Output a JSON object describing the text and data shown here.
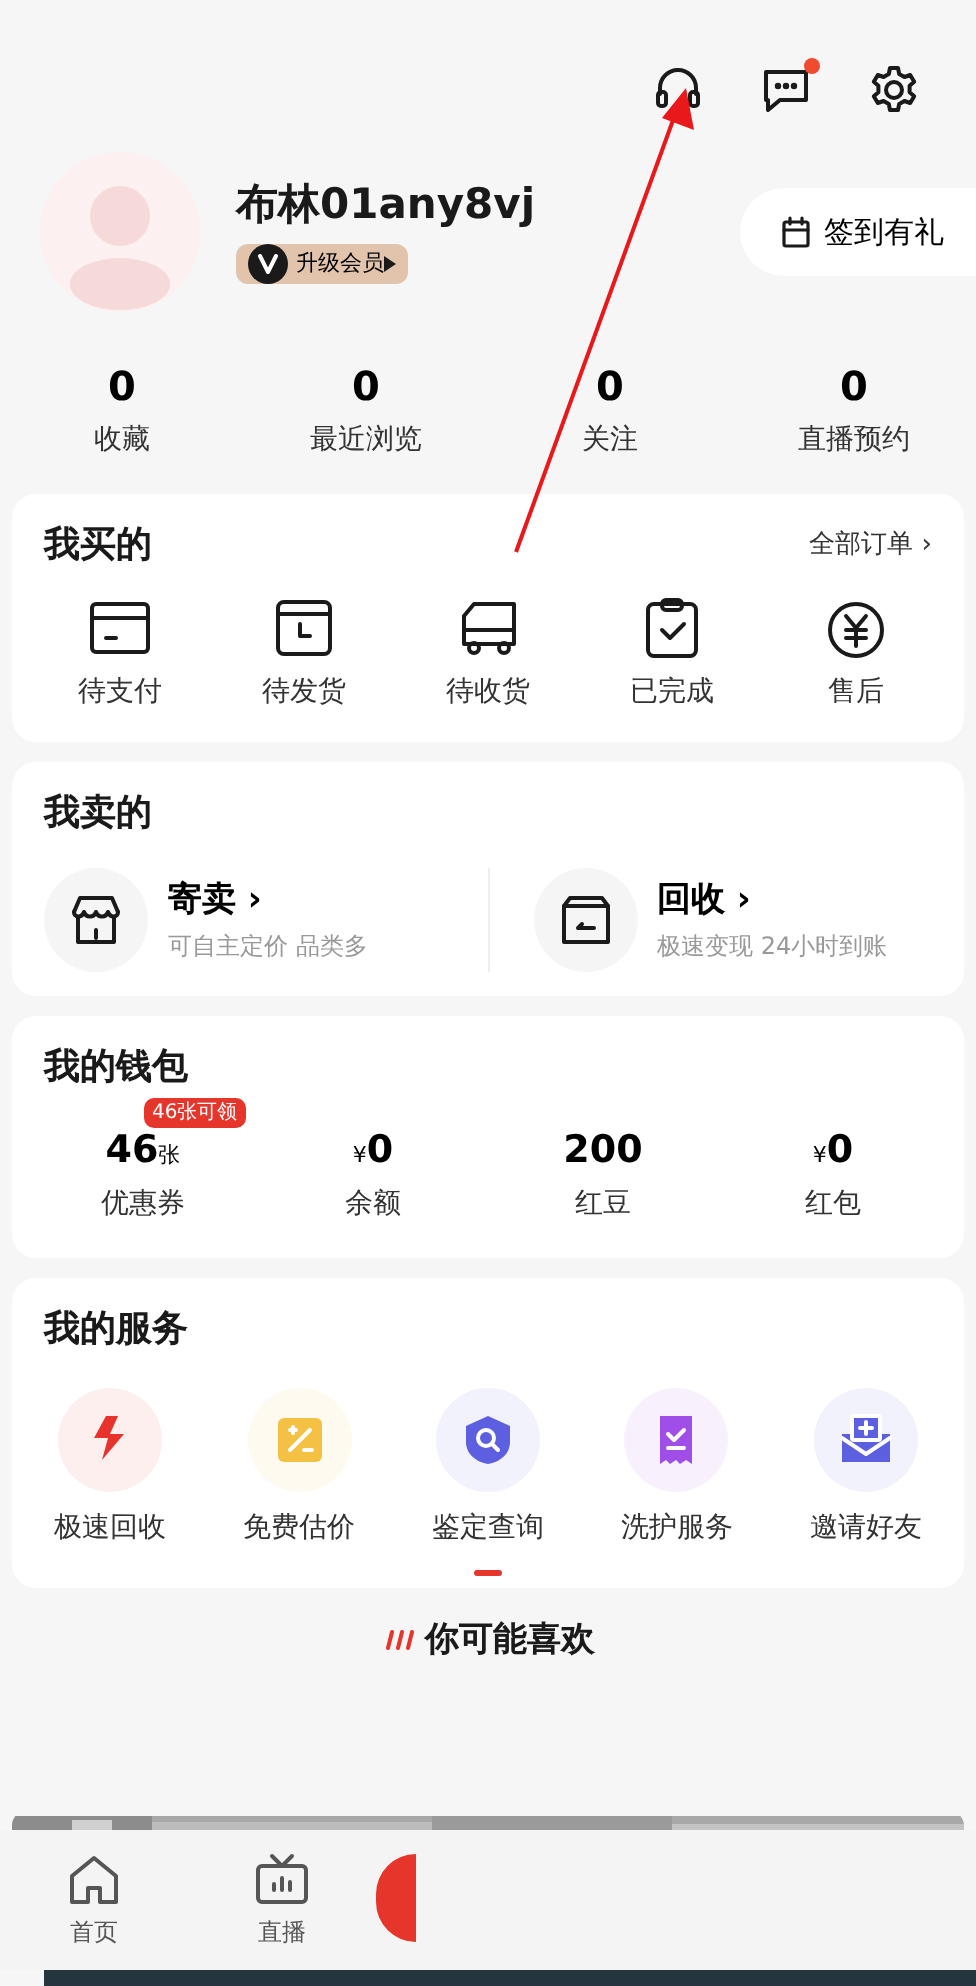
{
  "header": {
    "messages_unread": true
  },
  "profile": {
    "username": "布林01any8vj",
    "member_badge": "升级会员",
    "checkin_button": "签到有礼"
  },
  "stats": [
    {
      "value": "0",
      "label": "收藏"
    },
    {
      "value": "0",
      "label": "最近浏览"
    },
    {
      "value": "0",
      "label": "关注"
    },
    {
      "value": "0",
      "label": "直播预约"
    }
  ],
  "purchases": {
    "title": "我买的",
    "all_orders": "全部订单 ›",
    "items": [
      {
        "label": "待支付"
      },
      {
        "label": "待发货"
      },
      {
        "label": "待收货"
      },
      {
        "label": "已完成"
      },
      {
        "label": "售后"
      }
    ]
  },
  "selling": {
    "title": "我卖的",
    "items": [
      {
        "title": "寄卖 ›",
        "subtitle": "可自主定价 品类多"
      },
      {
        "title": "回收 ›",
        "subtitle": "极速变现 24小时到账"
      }
    ]
  },
  "wallet": {
    "title": "我的钱包",
    "items": [
      {
        "value": "46",
        "unit": "张",
        "badge": "46张可领",
        "label": "优惠券"
      },
      {
        "currency": "¥",
        "value": "0",
        "label": "余额"
      },
      {
        "value": "200",
        "label": "红豆"
      },
      {
        "currency": "¥",
        "value": "0",
        "label": "红包"
      }
    ]
  },
  "services": {
    "title": "我的服务",
    "items": [
      {
        "label": "极速回收",
        "color": "#e8332c"
      },
      {
        "label": "免费估价",
        "color": "#f4c145"
      },
      {
        "label": "鉴定查询",
        "color": "#5b5fe0"
      },
      {
        "label": "洗护服务",
        "color": "#a04ee8"
      },
      {
        "label": "邀请好友",
        "color": "#5b5fe0"
      }
    ]
  },
  "recommend": {
    "title": "你可能喜欢"
  },
  "bottom_nav": [
    {
      "label": "首页"
    },
    {
      "label": "直播"
    }
  ]
}
